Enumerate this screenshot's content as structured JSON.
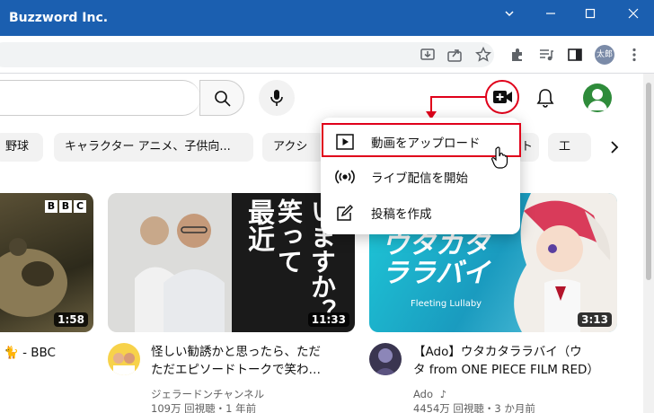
{
  "window": {
    "title": "Buzzword Inc.",
    "controls": [
      "chevron-down-icon",
      "minimize-icon",
      "maximize-icon",
      "close-icon"
    ]
  },
  "browser": {
    "toolbar_icons": [
      "install-app-icon",
      "share-icon",
      "star-icon",
      "extensions-icon",
      "media-queue-icon",
      "side-panel-icon"
    ],
    "profile_label": "太郎"
  },
  "youtube": {
    "chips": [
      "野球",
      "キャラクター アニメ、子供向...",
      "アクシ",
      "ト",
      "工"
    ],
    "menu": {
      "items": [
        {
          "icon": "play-icon",
          "label": "動画をアップロード"
        },
        {
          "icon": "broadcast-icon",
          "label": "ライブ配信を開始"
        },
        {
          "icon": "edit-icon",
          "label": "投稿を作成"
        }
      ]
    },
    "videos": [
      {
        "badge": "BBC",
        "duration": "1:58",
        "title": "🐈 - BBC"
      },
      {
        "duration": "11:33",
        "title_line1": "怪しい勧誘かと思ったら、ただ",
        "title_line2": "ただエピソードトークで笑わ…",
        "channel": "ジェラードンチャンネル",
        "stats": "109万 回視聴・1 年前",
        "thumb_text_1": "笑って",
        "thumb_text_2": "いますか？",
        "thumb_text_3": "最近"
      },
      {
        "duration": "3:13",
        "title_line1": "【Ado】ウタカタララバイ（ウ",
        "title_line2": "タ from ONE PIECE FILM RED）",
        "channel": "Ado",
        "stats": "4454万 回視聴・3 か月前",
        "thumb_text_1": "ウタカタ",
        "thumb_text_2": "ララバイ",
        "thumb_text_3": "Fleeting Lullaby"
      }
    ]
  }
}
